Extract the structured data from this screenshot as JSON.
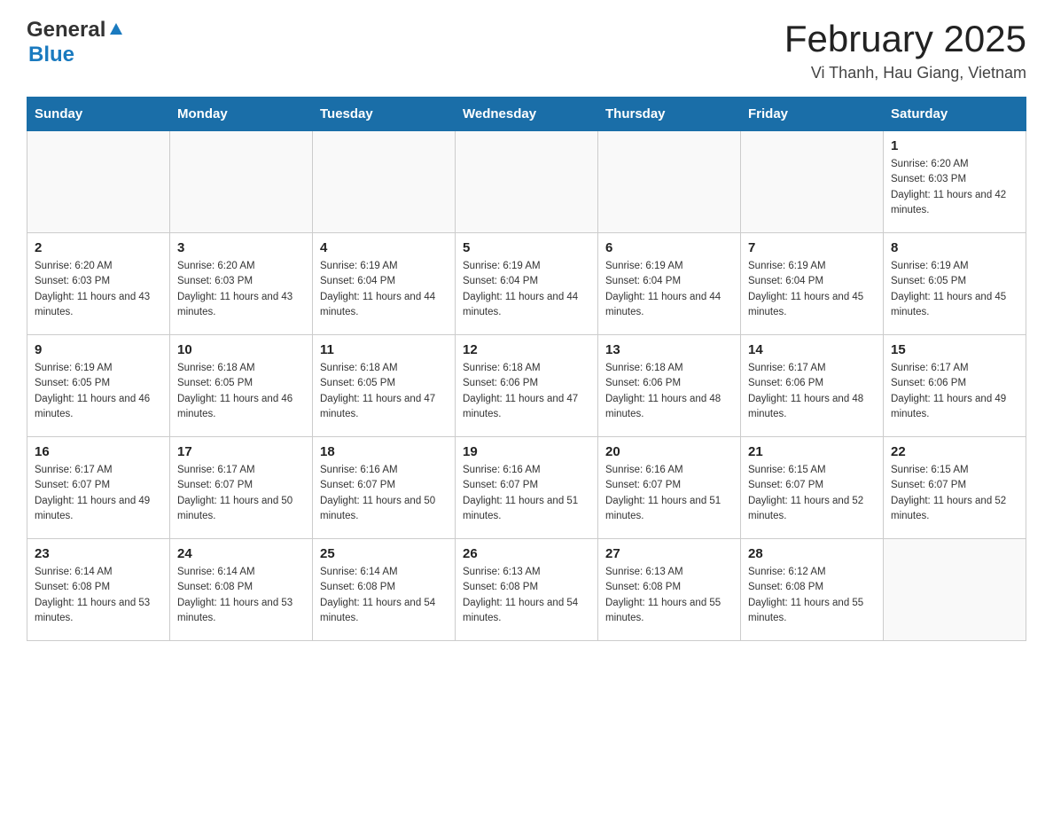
{
  "header": {
    "logo_general": "General",
    "logo_blue": "Blue",
    "title": "February 2025",
    "location": "Vi Thanh, Hau Giang, Vietnam"
  },
  "days_of_week": [
    "Sunday",
    "Monday",
    "Tuesday",
    "Wednesday",
    "Thursday",
    "Friday",
    "Saturday"
  ],
  "weeks": [
    [
      {
        "day": "",
        "info": ""
      },
      {
        "day": "",
        "info": ""
      },
      {
        "day": "",
        "info": ""
      },
      {
        "day": "",
        "info": ""
      },
      {
        "day": "",
        "info": ""
      },
      {
        "day": "",
        "info": ""
      },
      {
        "day": "1",
        "info": "Sunrise: 6:20 AM\nSunset: 6:03 PM\nDaylight: 11 hours and 42 minutes."
      }
    ],
    [
      {
        "day": "2",
        "info": "Sunrise: 6:20 AM\nSunset: 6:03 PM\nDaylight: 11 hours and 43 minutes."
      },
      {
        "day": "3",
        "info": "Sunrise: 6:20 AM\nSunset: 6:03 PM\nDaylight: 11 hours and 43 minutes."
      },
      {
        "day": "4",
        "info": "Sunrise: 6:19 AM\nSunset: 6:04 PM\nDaylight: 11 hours and 44 minutes."
      },
      {
        "day": "5",
        "info": "Sunrise: 6:19 AM\nSunset: 6:04 PM\nDaylight: 11 hours and 44 minutes."
      },
      {
        "day": "6",
        "info": "Sunrise: 6:19 AM\nSunset: 6:04 PM\nDaylight: 11 hours and 44 minutes."
      },
      {
        "day": "7",
        "info": "Sunrise: 6:19 AM\nSunset: 6:04 PM\nDaylight: 11 hours and 45 minutes."
      },
      {
        "day": "8",
        "info": "Sunrise: 6:19 AM\nSunset: 6:05 PM\nDaylight: 11 hours and 45 minutes."
      }
    ],
    [
      {
        "day": "9",
        "info": "Sunrise: 6:19 AM\nSunset: 6:05 PM\nDaylight: 11 hours and 46 minutes."
      },
      {
        "day": "10",
        "info": "Sunrise: 6:18 AM\nSunset: 6:05 PM\nDaylight: 11 hours and 46 minutes."
      },
      {
        "day": "11",
        "info": "Sunrise: 6:18 AM\nSunset: 6:05 PM\nDaylight: 11 hours and 47 minutes."
      },
      {
        "day": "12",
        "info": "Sunrise: 6:18 AM\nSunset: 6:06 PM\nDaylight: 11 hours and 47 minutes."
      },
      {
        "day": "13",
        "info": "Sunrise: 6:18 AM\nSunset: 6:06 PM\nDaylight: 11 hours and 48 minutes."
      },
      {
        "day": "14",
        "info": "Sunrise: 6:17 AM\nSunset: 6:06 PM\nDaylight: 11 hours and 48 minutes."
      },
      {
        "day": "15",
        "info": "Sunrise: 6:17 AM\nSunset: 6:06 PM\nDaylight: 11 hours and 49 minutes."
      }
    ],
    [
      {
        "day": "16",
        "info": "Sunrise: 6:17 AM\nSunset: 6:07 PM\nDaylight: 11 hours and 49 minutes."
      },
      {
        "day": "17",
        "info": "Sunrise: 6:17 AM\nSunset: 6:07 PM\nDaylight: 11 hours and 50 minutes."
      },
      {
        "day": "18",
        "info": "Sunrise: 6:16 AM\nSunset: 6:07 PM\nDaylight: 11 hours and 50 minutes."
      },
      {
        "day": "19",
        "info": "Sunrise: 6:16 AM\nSunset: 6:07 PM\nDaylight: 11 hours and 51 minutes."
      },
      {
        "day": "20",
        "info": "Sunrise: 6:16 AM\nSunset: 6:07 PM\nDaylight: 11 hours and 51 minutes."
      },
      {
        "day": "21",
        "info": "Sunrise: 6:15 AM\nSunset: 6:07 PM\nDaylight: 11 hours and 52 minutes."
      },
      {
        "day": "22",
        "info": "Sunrise: 6:15 AM\nSunset: 6:07 PM\nDaylight: 11 hours and 52 minutes."
      }
    ],
    [
      {
        "day": "23",
        "info": "Sunrise: 6:14 AM\nSunset: 6:08 PM\nDaylight: 11 hours and 53 minutes."
      },
      {
        "day": "24",
        "info": "Sunrise: 6:14 AM\nSunset: 6:08 PM\nDaylight: 11 hours and 53 minutes."
      },
      {
        "day": "25",
        "info": "Sunrise: 6:14 AM\nSunset: 6:08 PM\nDaylight: 11 hours and 54 minutes."
      },
      {
        "day": "26",
        "info": "Sunrise: 6:13 AM\nSunset: 6:08 PM\nDaylight: 11 hours and 54 minutes."
      },
      {
        "day": "27",
        "info": "Sunrise: 6:13 AM\nSunset: 6:08 PM\nDaylight: 11 hours and 55 minutes."
      },
      {
        "day": "28",
        "info": "Sunrise: 6:12 AM\nSunset: 6:08 PM\nDaylight: 11 hours and 55 minutes."
      },
      {
        "day": "",
        "info": ""
      }
    ]
  ]
}
